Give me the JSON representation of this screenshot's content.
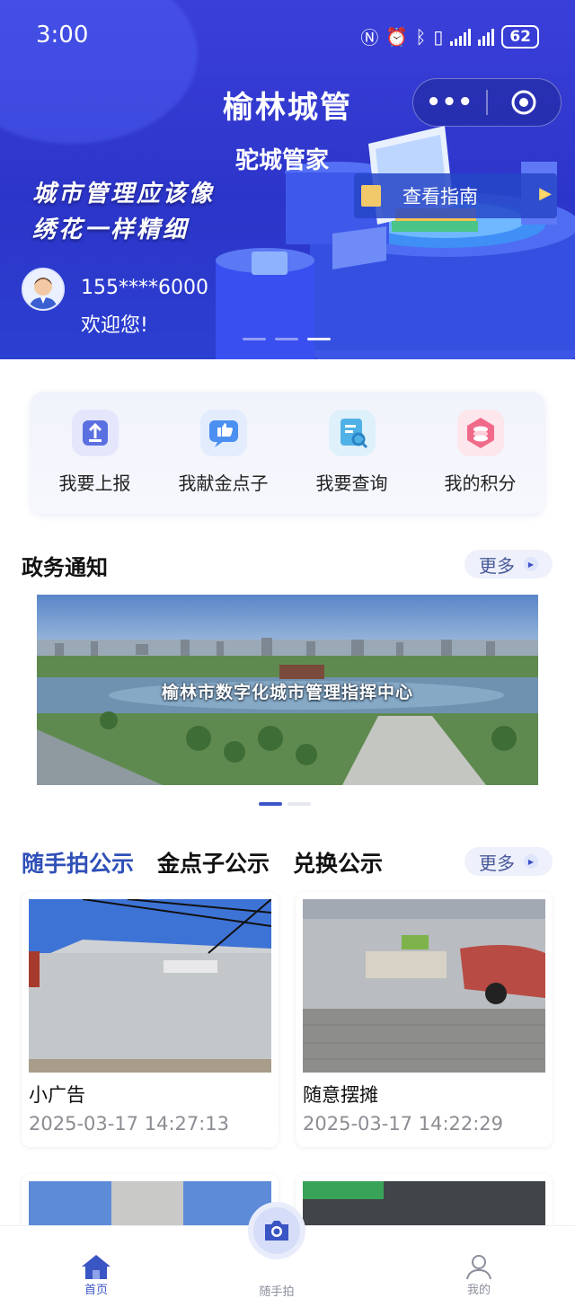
{
  "status_bar": {
    "time": "3:00",
    "battery": "62"
  },
  "header": {
    "title": "榆林城管",
    "menu_glyph": "•••"
  },
  "hero": {
    "subtitle": "驼城管家",
    "slogan_line1": "城市管理应该像",
    "slogan_line2": "绣花一样精细",
    "guide_label": "查看指南",
    "user_phone": "155****6000",
    "welcome": "欢迎您!"
  },
  "quick_actions": [
    {
      "label": "我要上报",
      "icon": "upload-icon",
      "color": "#5a6fe0"
    },
    {
      "label": "我献金点子",
      "icon": "thumbs-up-icon",
      "color": "#4b8ff0"
    },
    {
      "label": "我要查询",
      "icon": "search-document-icon",
      "color": "#4fb1e6"
    },
    {
      "label": "我的积分",
      "icon": "points-coin-icon",
      "color": "#f06a8a"
    }
  ],
  "notice": {
    "title": "政务通知",
    "more": "更多",
    "banner_caption": "榆林市数字化城市管理指挥中心"
  },
  "public": {
    "tabs": [
      "随手拍公示",
      "金点子公示",
      "兑换公示"
    ],
    "active_tab": 0,
    "more": "更多",
    "cards": [
      {
        "title": "小广告",
        "datetime": "2025-03-17 14:27:13"
      },
      {
        "title": "随意摆摊",
        "datetime": "2025-03-17 14:22:29"
      }
    ]
  },
  "bottom_nav": {
    "home": "首页",
    "snap": "随手拍",
    "mine": "我的"
  },
  "colors": {
    "brand": "#2f3fd0",
    "accent": "#3a55c4"
  }
}
